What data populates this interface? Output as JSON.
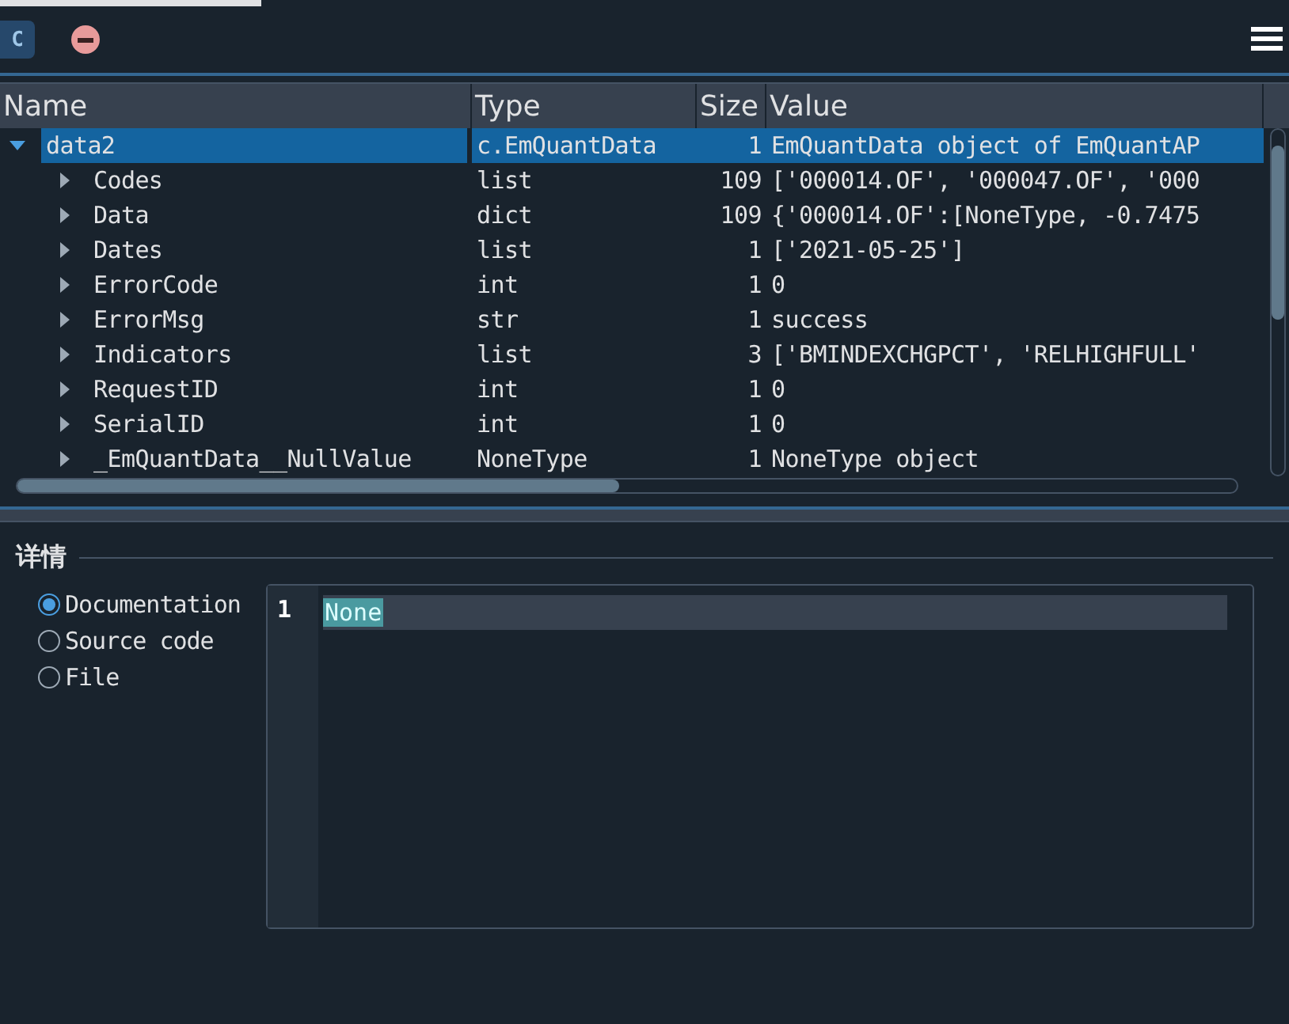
{
  "toolbar": {
    "console_badge": "C"
  },
  "table": {
    "columns": [
      "Name",
      "Type",
      "Size",
      "Value"
    ],
    "rows": [
      {
        "name": "data2",
        "type": "c.EmQuantData",
        "size": "1",
        "value": "EmQuantData object of EmQuantAP",
        "expanded": true,
        "selected": true,
        "children": [
          {
            "name": "Codes",
            "type": "list",
            "size": "109",
            "value": "['000014.OF', '000047.OF', '000",
            "expanded": false,
            "selected": false
          },
          {
            "name": "Data",
            "type": "dict",
            "size": "109",
            "value": "{'000014.OF':[NoneType, -0.7475",
            "expanded": false,
            "selected": false
          },
          {
            "name": "Dates",
            "type": "list",
            "size": "1",
            "value": "['2021-05-25']",
            "expanded": false,
            "selected": false
          },
          {
            "name": "ErrorCode",
            "type": "int",
            "size": "1",
            "value": "0",
            "expanded": false,
            "selected": false
          },
          {
            "name": "ErrorMsg",
            "type": "str",
            "size": "1",
            "value": "success",
            "expanded": false,
            "selected": false
          },
          {
            "name": "Indicators",
            "type": "list",
            "size": "3",
            "value": "['BMINDEXCHGPCT', 'RELHIGHFULL'",
            "expanded": false,
            "selected": false
          },
          {
            "name": "RequestID",
            "type": "int",
            "size": "1",
            "value": "0",
            "expanded": false,
            "selected": false
          },
          {
            "name": "SerialID",
            "type": "int",
            "size": "1",
            "value": "0",
            "expanded": false,
            "selected": false
          },
          {
            "name": "_EmQuantData__NullValue",
            "type": "NoneType",
            "size": "1",
            "value": "NoneType object",
            "expanded": false,
            "selected": false
          }
        ]
      }
    ]
  },
  "details": {
    "title": "详情",
    "options": [
      {
        "label": "Documentation",
        "selected": true
      },
      {
        "label": "Source code",
        "selected": false
      },
      {
        "label": "File",
        "selected": false
      }
    ],
    "editor": {
      "line_number": "1",
      "text": "None"
    }
  }
}
